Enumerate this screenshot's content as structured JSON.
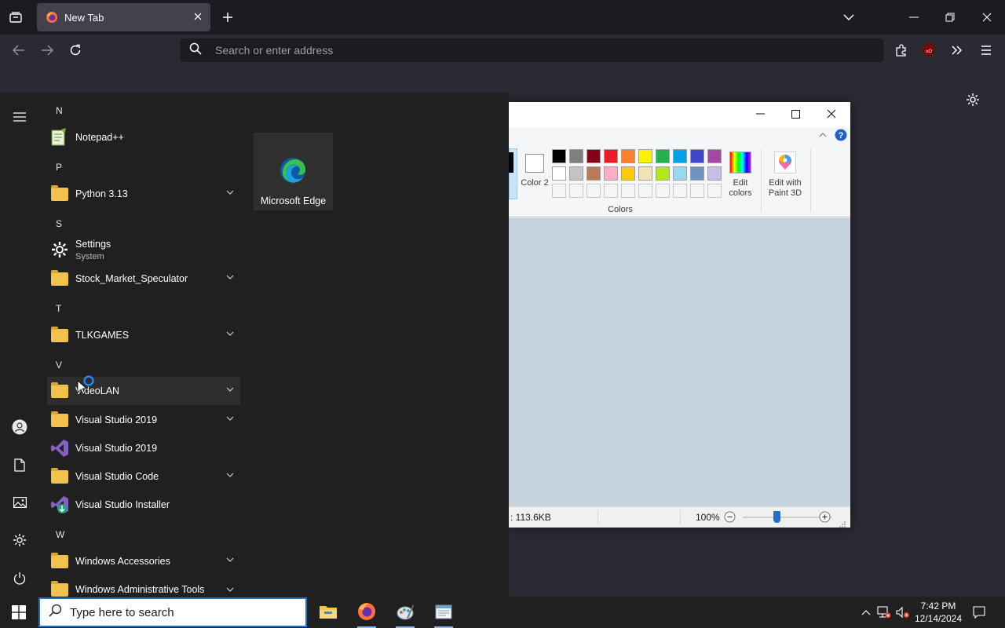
{
  "browser": {
    "tab_title": "New Tab",
    "url_placeholder": "Search or enter address"
  },
  "start_menu": {
    "groups": [
      {
        "letter": "N"
      },
      {
        "letter": "P"
      },
      {
        "letter": "S"
      },
      {
        "letter": "T"
      },
      {
        "letter": "V"
      },
      {
        "letter": "W"
      }
    ],
    "apps": [
      {
        "name": "Notepad++"
      },
      {
        "name": "Python 3.13"
      },
      {
        "name": "Settings",
        "sub": "System"
      },
      {
        "name": "Stock_Market_Speculator"
      },
      {
        "name": "TLKGAMES"
      },
      {
        "name": "VideoLAN"
      },
      {
        "name": "Visual Studio 2019"
      },
      {
        "name": "Visual Studio 2019"
      },
      {
        "name": "Visual Studio Code"
      },
      {
        "name": "Visual Studio Installer"
      },
      {
        "name": "Windows Accessories"
      },
      {
        "name": "Windows Administrative Tools"
      }
    ],
    "pinned_tile": "Microsoft Edge"
  },
  "paint": {
    "color2_label": "Color 2",
    "colors_group_label": "Colors",
    "edit_colors_label": "Edit colors",
    "edit_paint3d_label": "Edit with Paint 3D",
    "palette_row1": [
      "#000000",
      "#7f7f7f",
      "#880015",
      "#ed1c24",
      "#ff7f27",
      "#fff200",
      "#22b14c",
      "#00a2e8",
      "#3f48cc",
      "#a349a4"
    ],
    "palette_row2": [
      "#ffffff",
      "#c3c3c3",
      "#b97a57",
      "#ffaec9",
      "#ffc90e",
      "#efe4b0",
      "#b5e61d",
      "#99d9ea",
      "#7092be",
      "#c8bfe7"
    ],
    "status_size": ": 113.6KB",
    "zoom": "100%"
  },
  "taskbar": {
    "search_placeholder": "Type here to search",
    "time": "7:42 PM",
    "date": "12/14/2024"
  }
}
